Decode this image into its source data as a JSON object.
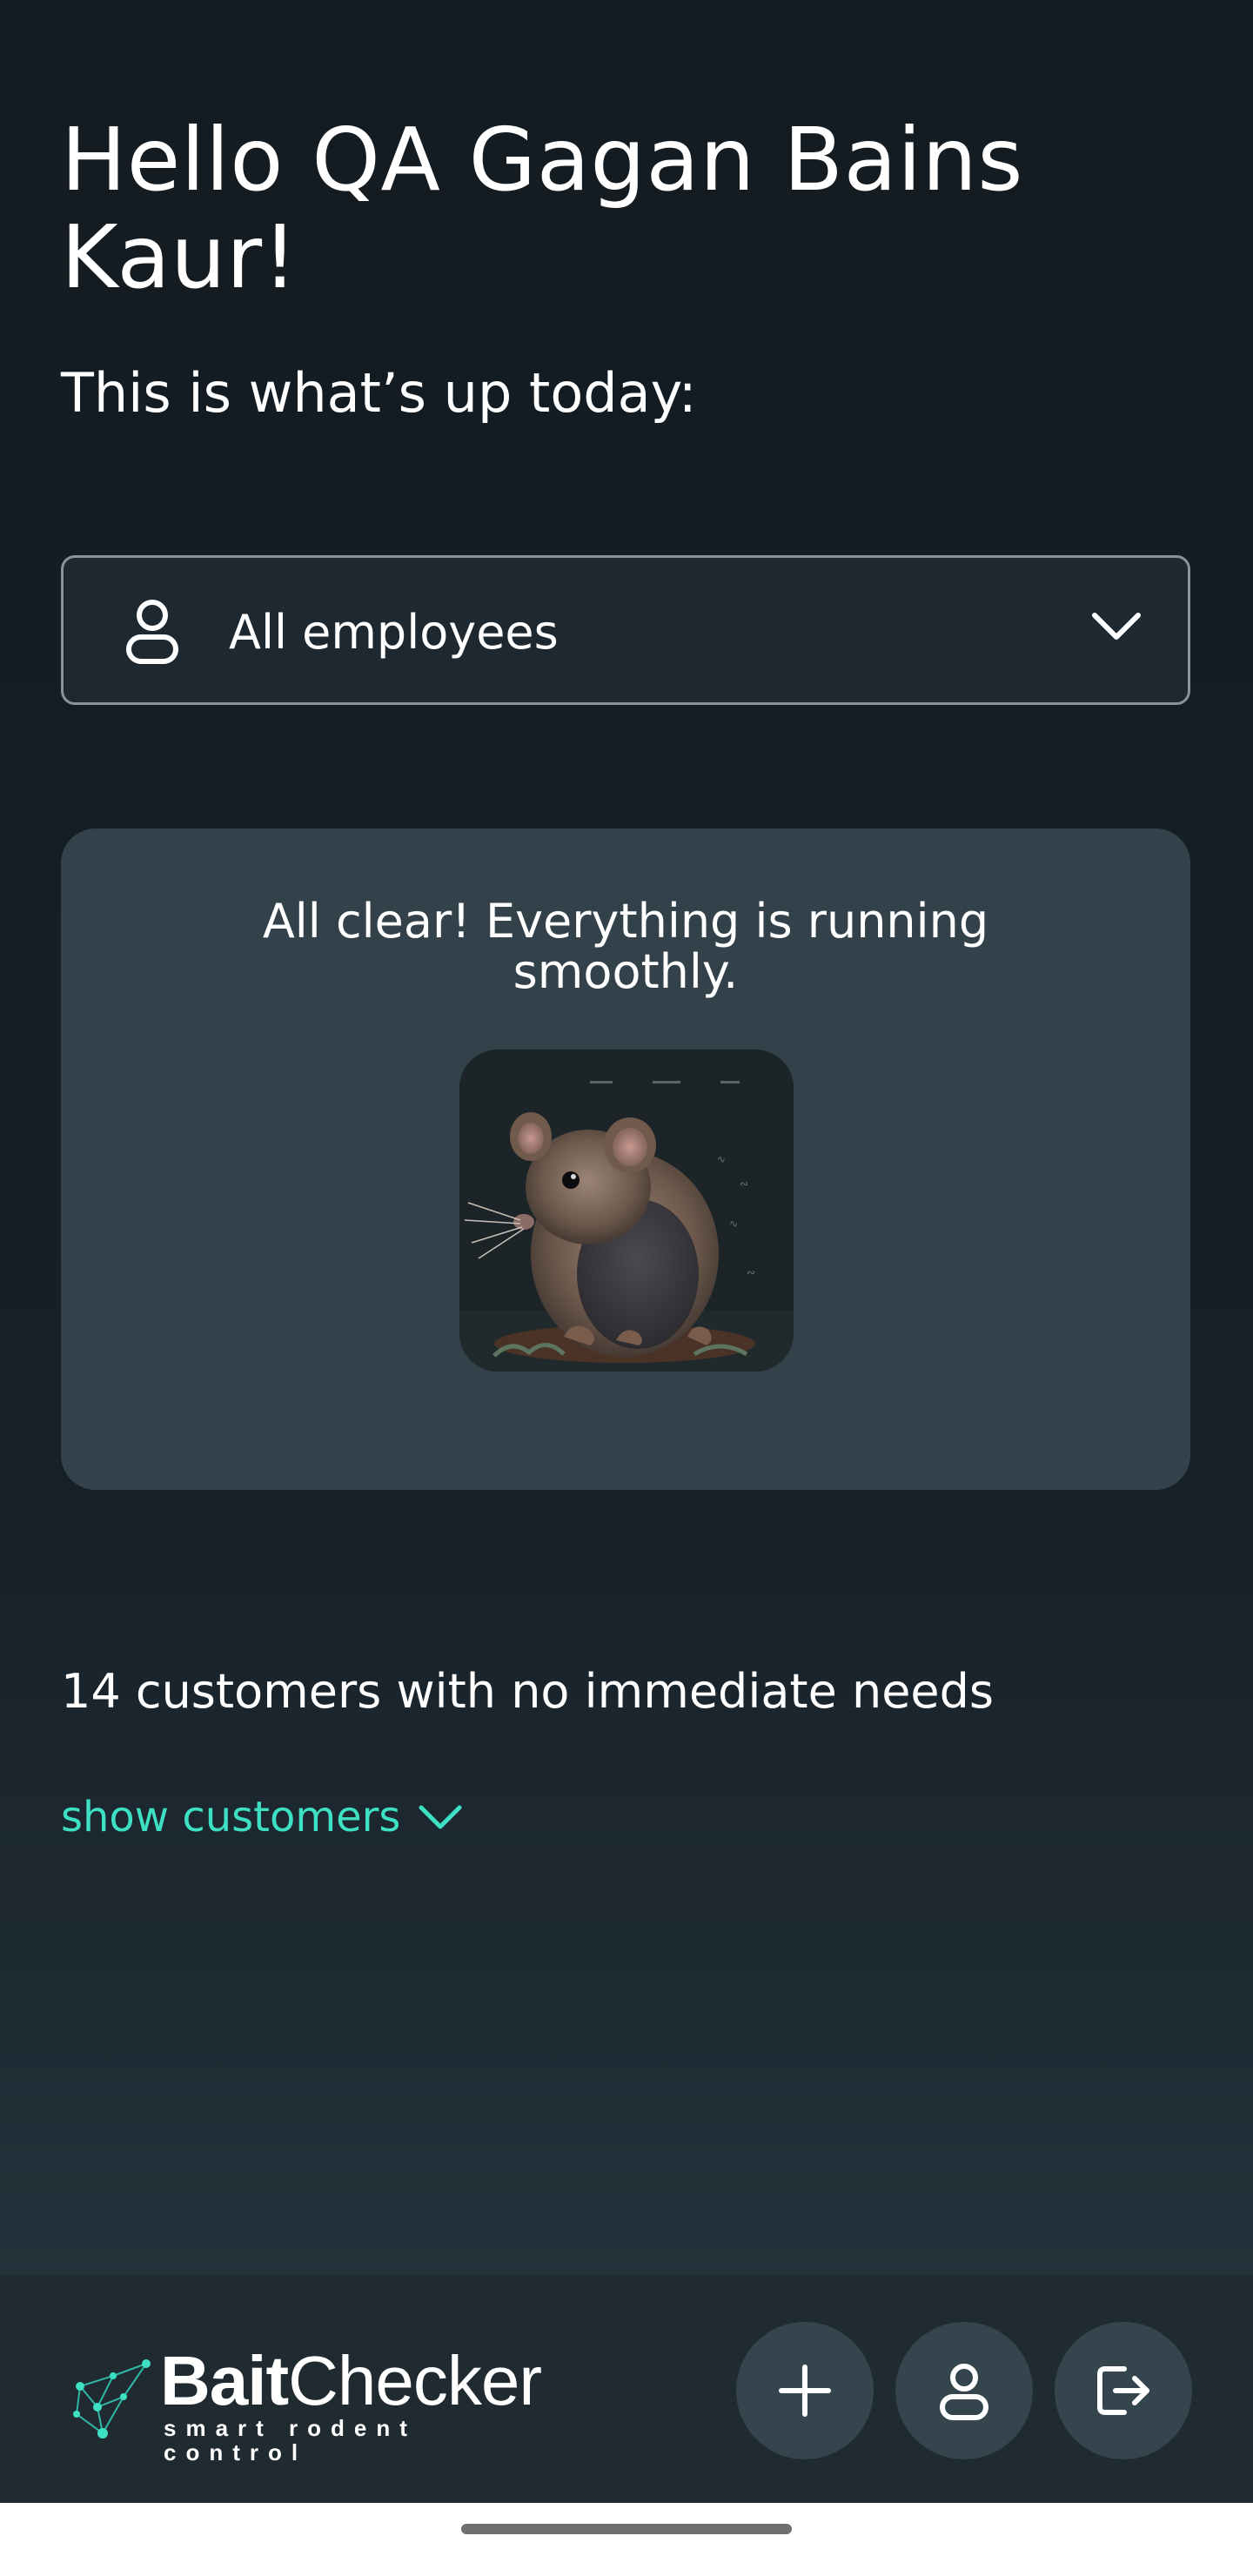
{
  "greeting": "Hello QA Gagan Bains Kaur!",
  "subtitle": "This is what’s up today:",
  "filter": {
    "selected": "All employees",
    "icon": "person-icon",
    "dropdown_icon": "chevron-down-icon"
  },
  "status_card": {
    "message_line1": "All clear! Everything is running",
    "message_line2": "smoothly.",
    "image": "rodent-illustration"
  },
  "customers": {
    "summary": "14 customers with no immediate needs",
    "toggle_label": "show customers",
    "toggle_icon": "chevron-down-icon"
  },
  "bottom_bar": {
    "logo_name_bold": "Bait",
    "logo_name_regular": "Checker",
    "logo_tagline": "smart rodent control",
    "actions": [
      {
        "icon": "plus-icon"
      },
      {
        "icon": "person-icon"
      },
      {
        "icon": "logout-icon"
      }
    ]
  },
  "colors": {
    "background": "#131b21",
    "card": "#33424a",
    "accent": "#3ee0c3",
    "button": "#34454d"
  }
}
